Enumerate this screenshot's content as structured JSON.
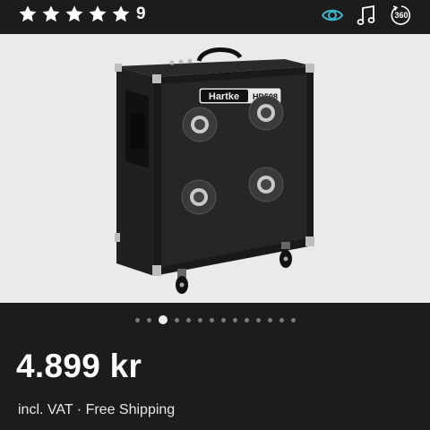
{
  "rating": {
    "stars": 5,
    "count": "9"
  },
  "top_icons": {
    "view": "eye-icon",
    "audio": "music-note-icon",
    "view360_label": "360"
  },
  "gallery": {
    "product_brand": "Hartke",
    "product_model": "HD508",
    "slide_count": 14,
    "active_slide": 2
  },
  "price": {
    "amount": "4.899 kr",
    "note": "incl. VAT · Free Shipping"
  },
  "colors": {
    "background": "#1c1c1c",
    "accent": "#3fb6c9",
    "gallery_bg": "#eaeaea"
  }
}
